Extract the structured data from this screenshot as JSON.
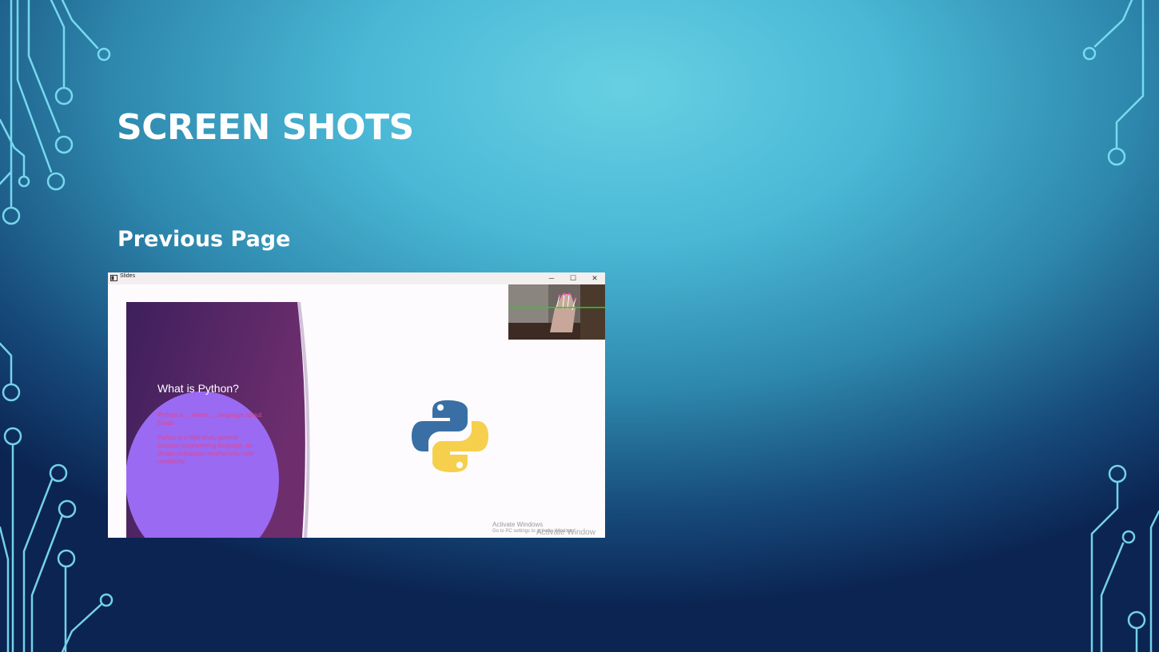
{
  "slide": {
    "title": "SCREEN SHOTS",
    "subtitle": "Previous Page"
  },
  "window": {
    "title": "Slides",
    "minimize_glyph": "─",
    "maximize_glyph": "☐",
    "close_glyph": "✕",
    "inner_slide": {
      "heading": "What is Python?",
      "pink_text_1": "Python is ... lorem ... language about Guido",
      "pink_text_2": "Python is a high-level, general-purpose programming language. Its design philosophy emphasizes code readability."
    },
    "watermark": {
      "line1": "Activate Windows",
      "line2": "Go to PC settings to activate Windows.",
      "ghost": "Activate Window"
    }
  },
  "colors": {
    "background_center": "#67d0e2",
    "background_edge": "#0b2452",
    "circuit_line": "#7fe4f7",
    "inner_slide_purple": "#5a2a72",
    "inner_blob": "#9a6af2",
    "inner_pink_text": "#e2458e"
  },
  "icons": [
    "python-logo-icon",
    "app-icon",
    "minimize-icon",
    "maximize-icon",
    "close-icon"
  ]
}
